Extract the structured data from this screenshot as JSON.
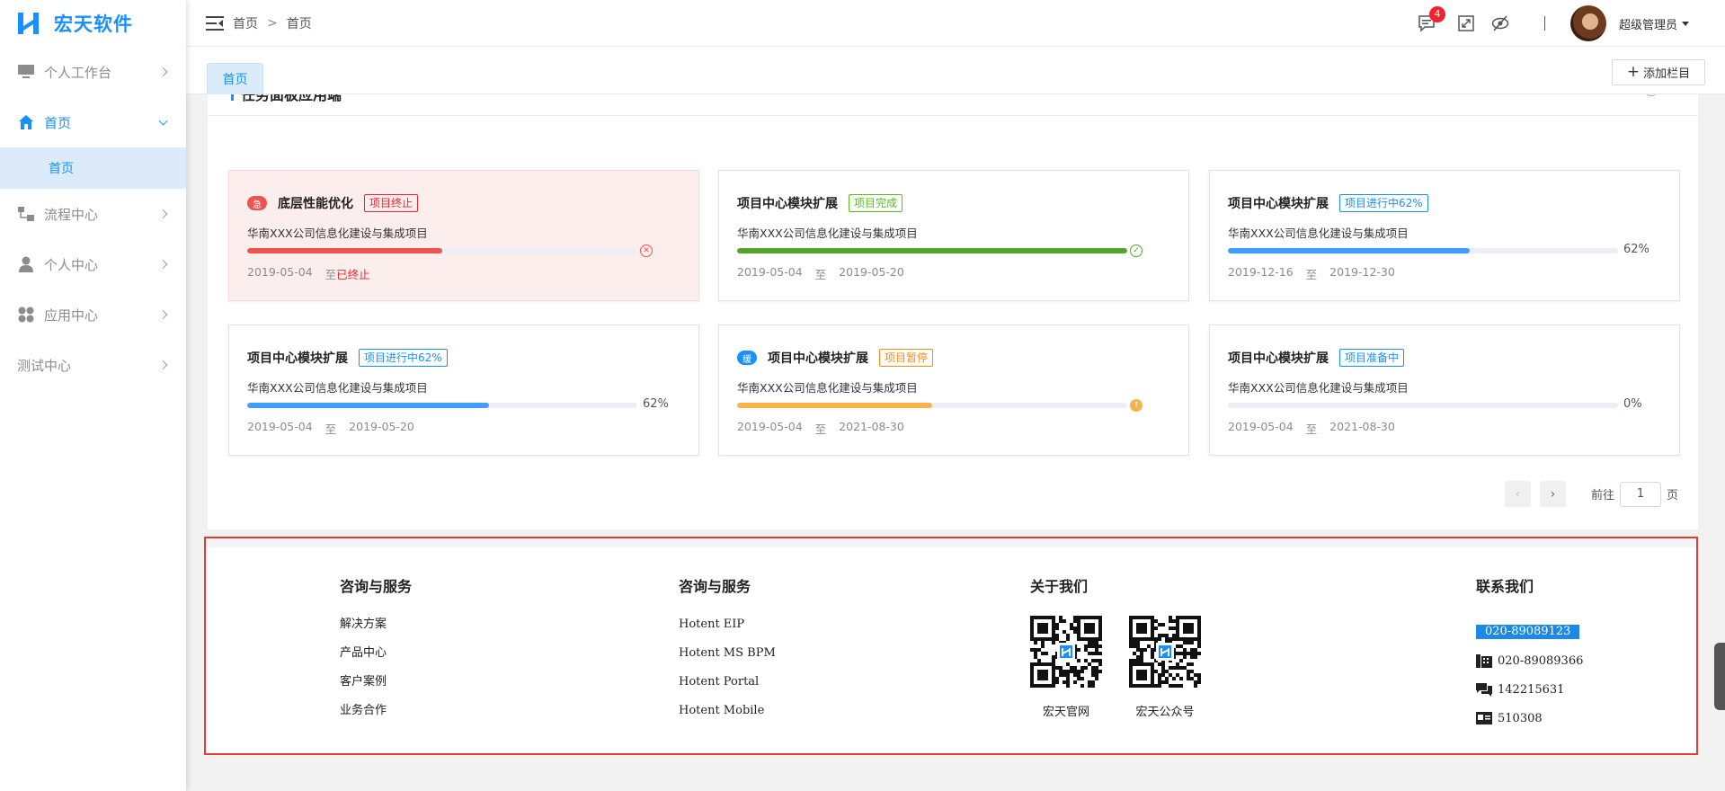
{
  "brand": {
    "name": "宏天软件",
    "color": "#1890ff"
  },
  "sidebar": {
    "items": [
      {
        "label": "个人工作台",
        "icon": "monitor-icon"
      },
      {
        "label": "首页",
        "icon": "home-icon",
        "open": true,
        "children": [
          {
            "label": "首页"
          }
        ]
      },
      {
        "label": "流程中心",
        "icon": "flow-icon"
      },
      {
        "label": "个人中心",
        "icon": "user-icon"
      },
      {
        "label": "应用中心",
        "icon": "apps-icon"
      },
      {
        "label": "测试中心",
        "icon": ""
      }
    ]
  },
  "header": {
    "breadcrumb": [
      "首页",
      "首页"
    ],
    "breadcrumb_sep": ">",
    "message_count": "4",
    "user_name": "超级管理员"
  },
  "tabs": {
    "active": "首页",
    "add_label": "添加栏目"
  },
  "panel": {
    "title": "任务面板应用端",
    "cards": [
      {
        "title": "底层性能优化",
        "priority": "急",
        "tag": "项目终止",
        "tag_color": "#f5222d",
        "subtitle": "华南XXX公司信息化建设与集成项目",
        "progress": 50,
        "bar_color": "#ef5350",
        "status": "terminated",
        "start": "2019-05-04",
        "to": "至",
        "end": "已终止",
        "danger": true
      },
      {
        "title": "项目中心模块扩展",
        "priority": "",
        "tag": "项目完成",
        "tag_color": "#52c41a",
        "subtitle": "华南XXX公司信息化建设与集成项目",
        "progress": 100,
        "bar_color": "#52a42a",
        "status": "done",
        "start": "2019-05-04",
        "to": "至",
        "end": "2019-05-20"
      },
      {
        "title": "项目中心模块扩展",
        "priority": "",
        "tag": "项目进行中62%",
        "tag_color": "#1890ff",
        "subtitle": "华南XXX公司信息化建设与集成项目",
        "progress": 62,
        "bar_color": "#409eff",
        "status": "percent",
        "percent_text": "62%",
        "start": "2019-12-16",
        "to": "至",
        "end": "2019-12-30"
      },
      {
        "title": "项目中心模块扩展",
        "priority": "",
        "tag": "项目进行中62%",
        "tag_color": "#1890ff",
        "subtitle": "华南XXX公司信息化建设与集成项目",
        "progress": 62,
        "bar_color": "#409eff",
        "status": "percent",
        "percent_text": "62%",
        "start": "2019-05-04",
        "to": "至",
        "end": "2019-05-20"
      },
      {
        "title": "项目中心模块扩展",
        "priority": "缓",
        "tag": "项目暂停",
        "tag_color": "#fa8c16",
        "subtitle": "华南XXX公司信息化建设与集成项目",
        "progress": 50,
        "bar_color": "#f7b24a",
        "status": "paused",
        "start": "2019-05-04",
        "to": "至",
        "end": "2021-08-30"
      },
      {
        "title": "项目中心模块扩展",
        "priority": "",
        "tag": "项目准备中",
        "tag_color": "#1890ff",
        "subtitle": "华南XXX公司信息化建设与集成项目",
        "progress": 0,
        "bar_color": "#409eff",
        "status": "percent",
        "percent_text": "0%",
        "start": "2019-05-04",
        "to": "至",
        "end": "2021-08-30"
      }
    ],
    "pager": {
      "goto_label": "前往",
      "page": "1",
      "page_suffix": "页"
    }
  },
  "footer": {
    "col1": {
      "title": "咨询与服务",
      "links": [
        "解决方案",
        "产品中心",
        "客户案例",
        "业务合作"
      ]
    },
    "col2": {
      "title": "咨询与服务",
      "links": [
        "Hotent EIP",
        "Hotent MS BPM",
        "Hotent Portal",
        "Hotent Mobile"
      ]
    },
    "col3": {
      "title": "关于我们",
      "qrs": [
        "宏天官网",
        "宏天公众号"
      ]
    },
    "col4": {
      "title": "联系我们",
      "highlight_phone": "020-89089123",
      "contacts": [
        {
          "icon": "phone-icon",
          "text": "020-89089366"
        },
        {
          "icon": "chat-icon",
          "text": "142215631"
        },
        {
          "icon": "card-icon",
          "text": "510308"
        }
      ]
    }
  }
}
